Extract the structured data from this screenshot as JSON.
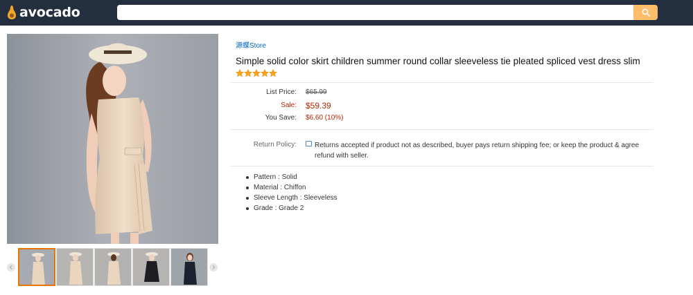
{
  "header": {
    "logo_text": "avocado",
    "search_placeholder": ""
  },
  "gallery": {
    "thumbnail_count": 5
  },
  "product": {
    "store": "源蝶Store",
    "title": "Simple solid color skirt children summer round collar sleeveless tie pleated spliced vest dress slim",
    "rating_stars": 5,
    "list_price_label": "List Price:",
    "list_price": "$65.99",
    "sale_label": "Sale:",
    "sale_price": "$59.39",
    "you_save_label": "You Save:",
    "you_save": "$6.60 (10%)",
    "return_policy_label": "Return Policy:",
    "return_policy_text": "Returns accepted if product not as described, buyer pays return shipping fee; or keep the product & agree refund with seller.",
    "attributes": [
      "Pattern : Solid",
      "Material : Chiffon",
      "Sleeve Length : Sleeveless",
      "Grade : Grade 2"
    ]
  },
  "colors": {
    "header_bg": "#232f3e",
    "search_button": "#febd69",
    "link": "#0066c0",
    "price_red": "#b12704",
    "star": "#ffa41c"
  }
}
